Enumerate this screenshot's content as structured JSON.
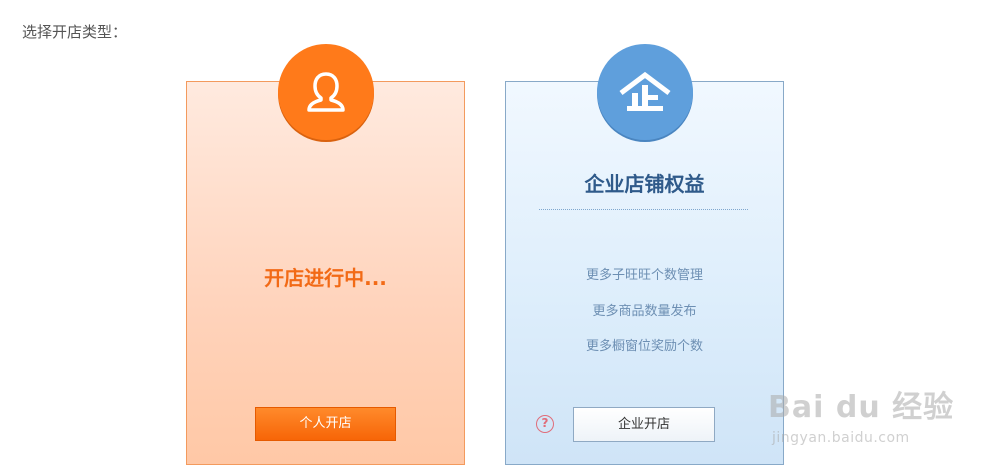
{
  "prompt": "选择开店类型：",
  "personal_card": {
    "icon": "person-icon",
    "status": "开店进行中...",
    "button_label": "个人开店"
  },
  "enterprise_card": {
    "icon": "enterprise-building-icon",
    "title": "企业店铺权益",
    "benefits": [
      "更多子旺旺个数管理",
      "更多商品数量发布",
      "更多橱窗位奖励个数"
    ],
    "help_symbol": "?",
    "button_label": "企业开店"
  },
  "watermark": {
    "logo": "Bai du 经验",
    "site": "jingyan.baidu.com"
  },
  "colors": {
    "orange": "#ff7a1a",
    "blue": "#5f9fdc",
    "enterprise_title": "#2f5a8a"
  }
}
